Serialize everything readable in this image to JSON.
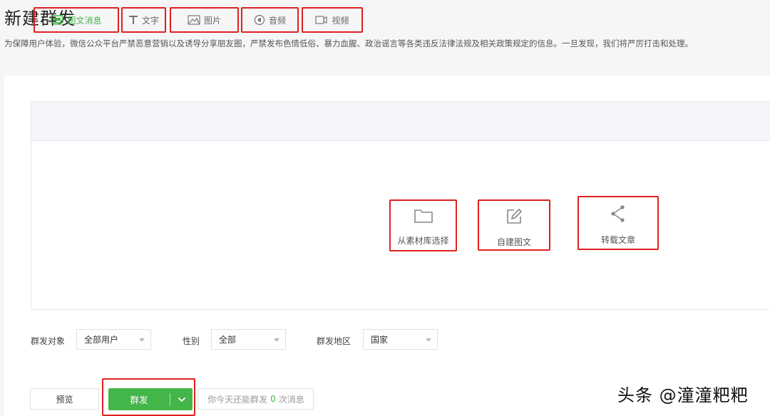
{
  "header": {
    "title": "新建群发",
    "notice": "为保障用户体验，微信公众平台严禁恶意营销以及诱导分享朋友圈，严禁发布色情低俗、暴力血腥、政治谣言等各类违反法律法规及相关政策规定的信息。一旦发现，我们将严厉打击和处理。"
  },
  "tabs": [
    {
      "label": "图文消息",
      "icon": "news-icon",
      "active": true
    },
    {
      "label": "文字",
      "icon": "text-icon",
      "active": false
    },
    {
      "label": "图片",
      "icon": "image-icon",
      "active": false
    },
    {
      "label": "音频",
      "icon": "audio-icon",
      "active": false
    },
    {
      "label": "视频",
      "icon": "video-icon",
      "active": false
    }
  ],
  "actions": [
    {
      "label": "从素材库选择",
      "icon": "folder-icon"
    },
    {
      "label": "自建图文",
      "icon": "edit-icon"
    },
    {
      "label": "转载文章",
      "icon": "share-icon"
    }
  ],
  "filters": {
    "target_label": "群发对象",
    "target_value": "全部用户",
    "gender_label": "性别",
    "gender_value": "全部",
    "region_label": "群发地区",
    "region_value": "国家"
  },
  "footer": {
    "preview_label": "预览",
    "send_label": "群发",
    "quota_prefix": "你今天还能群发",
    "quota_count": "0",
    "quota_suffix": "次消息"
  },
  "watermark": "头条 @潼潼粑粑",
  "colors": {
    "accent": "#44b549",
    "highlight_border": "#e02020"
  }
}
